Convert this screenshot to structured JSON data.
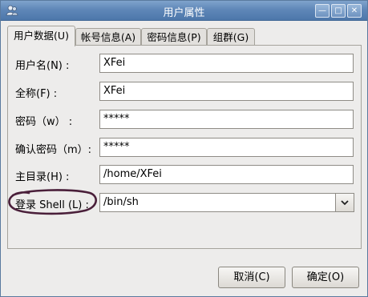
{
  "window": {
    "title": "用户属性",
    "controls": [
      "minimize-icon",
      "maximize-icon",
      "close-icon"
    ]
  },
  "tabs": [
    {
      "label": "用户数据(U)",
      "active": true
    },
    {
      "label": "帐号信息(A)",
      "active": false
    },
    {
      "label": "密码信息(P)",
      "active": false
    },
    {
      "label": "组群(G)",
      "active": false
    }
  ],
  "form": {
    "username": {
      "label": "用户名(N) :",
      "value": "XFei"
    },
    "fullname": {
      "label": "全称(F) :",
      "value": "XFei"
    },
    "password": {
      "label": "密码（w） :",
      "value": "*****"
    },
    "confirm": {
      "label": "确认密码（m）:",
      "value": "*****"
    },
    "home": {
      "label": "主目录(H) :",
      "value": "/home/XFei"
    },
    "shell": {
      "label": "登录 Shell (L) :",
      "value": "/bin/sh"
    }
  },
  "buttons": {
    "cancel": "取消(C)",
    "ok": "确定(O)"
  },
  "colors": {
    "titlebar": "#5f87b8",
    "annotation": "#4a1f3a"
  }
}
